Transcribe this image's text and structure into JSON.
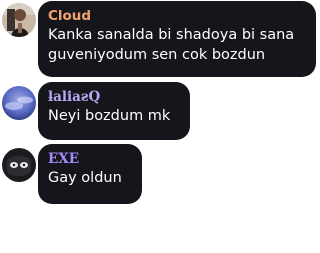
{
  "messages": [
    {
      "author": "Cloud",
      "author_color": "#f2a26f",
      "lines": [
        "Kanka sanalda bi shadoya bi sana",
        "guveniyodum sen cok bozdun"
      ]
    },
    {
      "author": "ƚaliaƨQ",
      "author_color": "#b9a6f2",
      "lines": [
        "Neyi bozdum mk"
      ]
    },
    {
      "author": "EXE",
      "author_color": "#a78bfa",
      "lines": [
        "Gay oldun"
      ]
    }
  ],
  "colors": {
    "bubble": "#15161c",
    "text": "#ffffff",
    "background": "#ffffff"
  },
  "icons": {
    "avatar_1": "person-avatar",
    "avatar_2": "cloudy-sky-avatar",
    "avatar_3": "masked-character-avatar"
  }
}
